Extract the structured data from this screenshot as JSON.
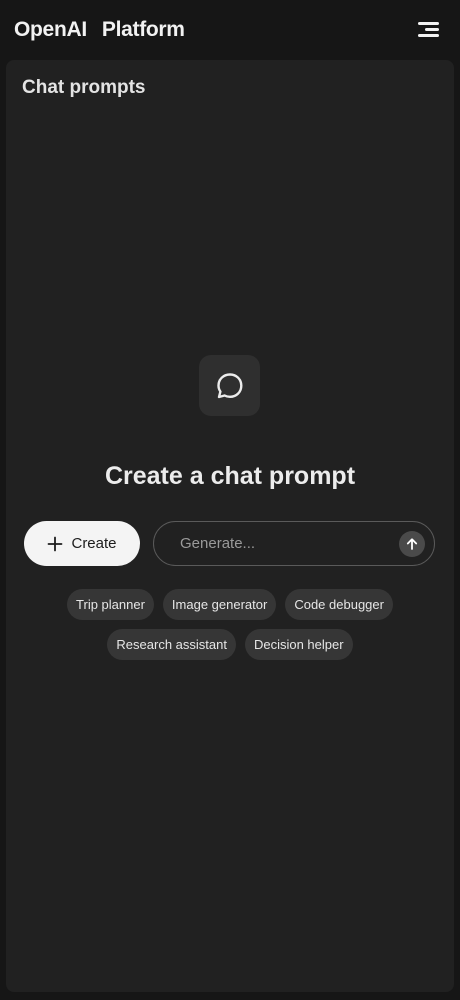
{
  "header": {
    "brand_name": "OpenAI",
    "product_name": "Platform",
    "menu_icon": "hamburger-menu-icon"
  },
  "panel": {
    "title": "Chat prompts"
  },
  "empty_state": {
    "icon": "chat-bubble-icon",
    "heading": "Create a chat prompt",
    "create_button_label": "Create",
    "create_button_icon": "plus-icon",
    "generate_placeholder": "Generate...",
    "send_icon": "arrow-up-icon"
  },
  "suggestions": [
    "Trip planner",
    "Image generator",
    "Code debugger",
    "Research assistant",
    "Decision helper"
  ],
  "colors": {
    "page_bg": "#161616",
    "panel_bg": "#212121",
    "chip_bg": "#363636",
    "create_button_bg": "#f4f4f4"
  }
}
